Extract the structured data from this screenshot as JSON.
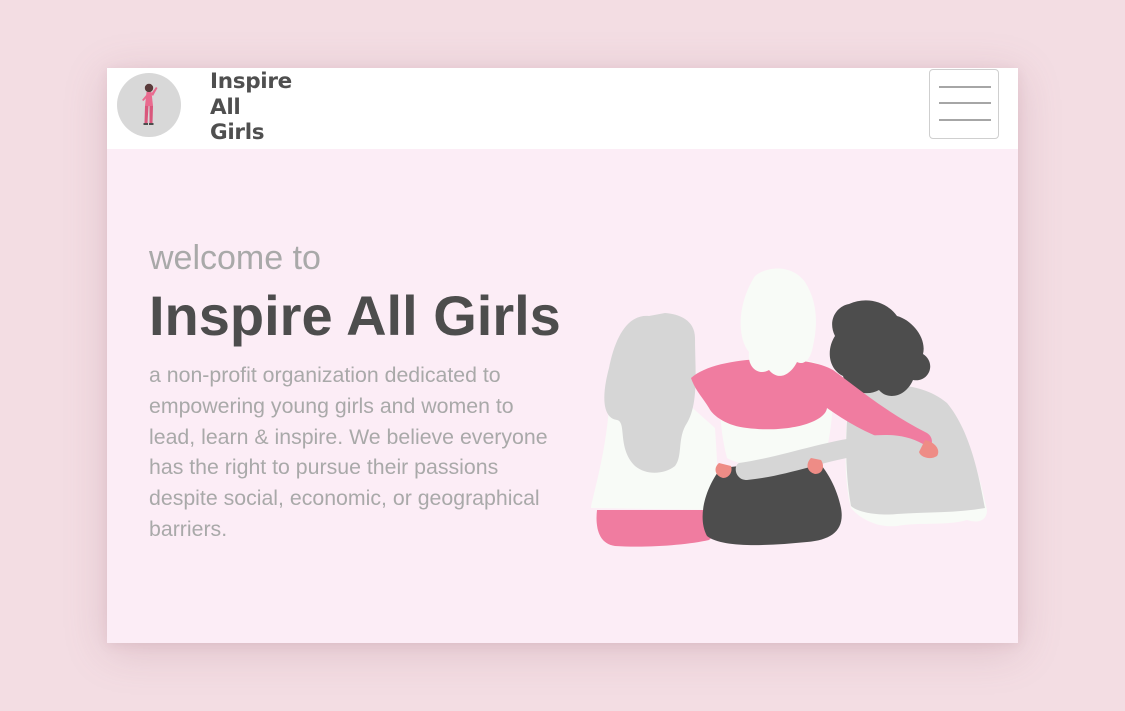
{
  "navbar": {
    "brand_line1": "Inspire",
    "brand_line2": "All",
    "brand_line3": "Girls",
    "menu_icon": "hamburger-menu-icon"
  },
  "hero": {
    "welcome": "welcome to",
    "title": "Inspire All Girls",
    "description": "a non-profit organization dedicated to empowering young girls and women to lead, learn & inspire. We believe everyone has the right to pursue their passions despite social, economic, or geographical barriers."
  },
  "colors": {
    "page_background": "#f3dde3",
    "hero_background": "#fcedf6",
    "navbar_background": "#ffffff",
    "accent_pink": "#f07ca0",
    "dark_gray": "#4d4d4d",
    "light_gray": "#a9a9a9"
  }
}
